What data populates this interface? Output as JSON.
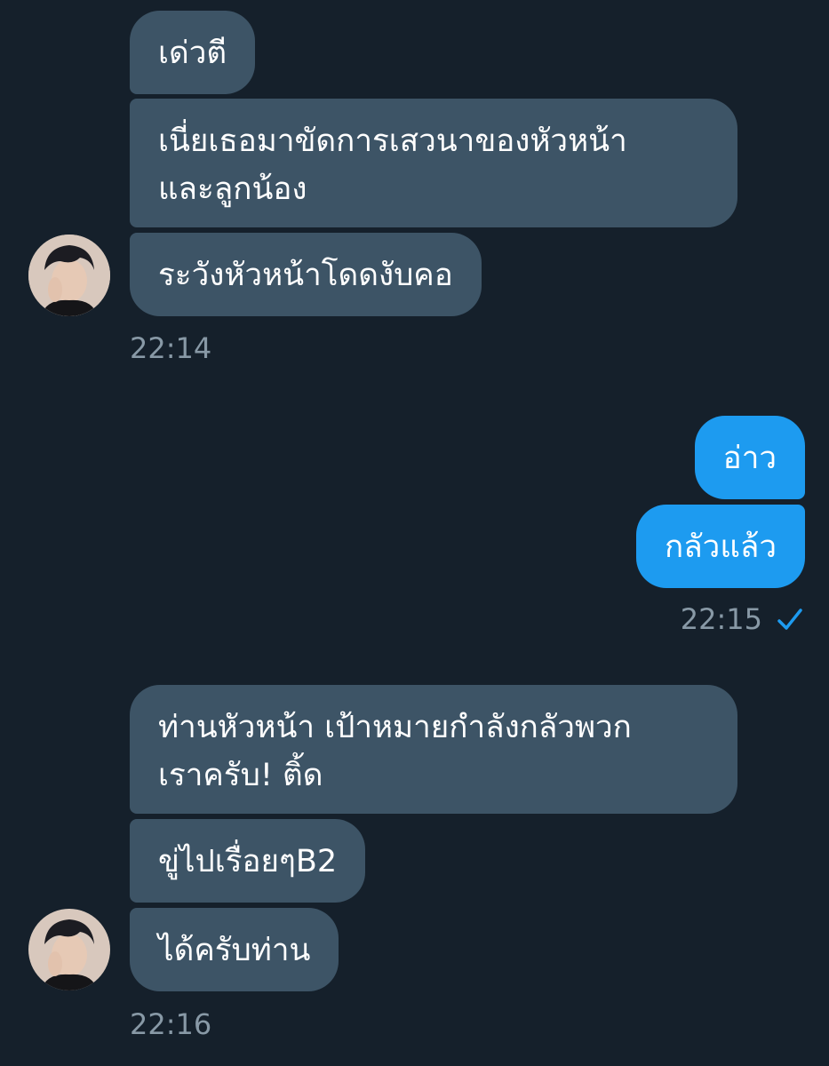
{
  "conversation": {
    "group1": {
      "messages": [
        {
          "text": "เด่วตี"
        },
        {
          "text": "เนี่ยเธอมาขัดการเสวนาของหัวหน้า\nและลูกน้อง"
        },
        {
          "text": "ระวังหัวหน้าโดดงับคอ"
        }
      ],
      "time": "22:14"
    },
    "group2": {
      "messages": [
        {
          "text": "อ่าว"
        },
        {
          "text": "กลัวแล้ว"
        }
      ],
      "time": "22:15",
      "status_icon": "check-icon"
    },
    "group3": {
      "messages": [
        {
          "text": "ท่านหัวหน้า เป้าหมายกำลังกลัวพวก\nเราครับ! ติ้ด"
        },
        {
          "text": "ขู่ไปเรื่อยๆB2"
        },
        {
          "text": "ได้ครับท่าน"
        }
      ],
      "time": "22:16"
    }
  },
  "colors": {
    "background": "#15202b",
    "incoming_bubble": "#3d5466",
    "outgoing_bubble": "#1d9bf0",
    "timestamp": "#8899a6",
    "check": "#1d9bf0"
  }
}
